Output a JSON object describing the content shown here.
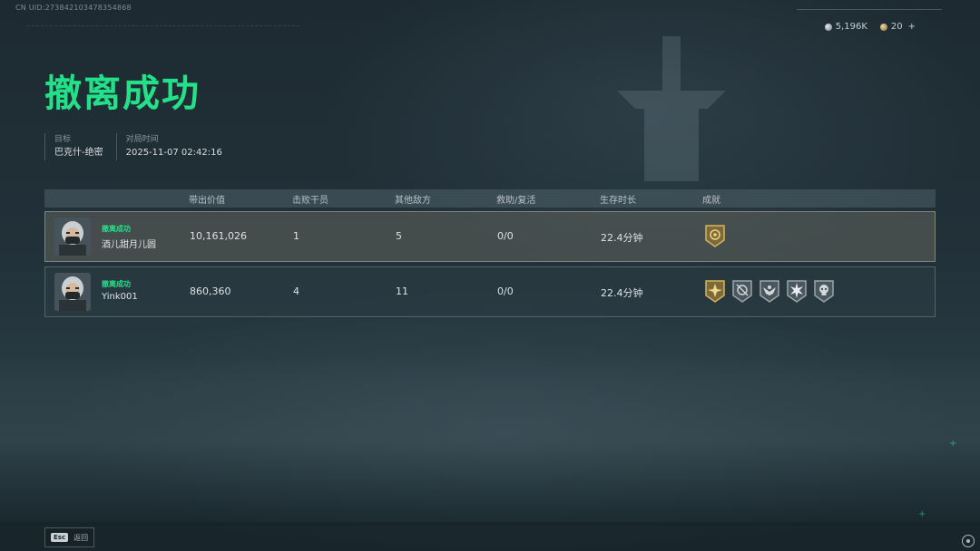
{
  "header": {
    "uid": "CN UID:273842103478354868",
    "currency": [
      {
        "icon": "silver-coin-icon",
        "value": "5,196K"
      },
      {
        "icon": "gold-coin-icon",
        "value": "20"
      }
    ],
    "add_symbol": "+"
  },
  "title": "撤离成功",
  "meta": [
    {
      "label": "目标",
      "value": "巴克什-绝密"
    },
    {
      "label": "对局时间",
      "value": "2025-11-07 02:42:16"
    }
  ],
  "table": {
    "columns": [
      "带出价值",
      "击败干员",
      "其他敌方",
      "救助/复活",
      "生存时长",
      "成就"
    ],
    "rows": [
      {
        "status": "撤离成功",
        "name": "酒儿甜月儿圆",
        "value": "10,161,026",
        "kills": "1",
        "others": "5",
        "rescue": "0/0",
        "time": "22.4分钟",
        "badges": [
          "gold-shield-badge-icon"
        ]
      },
      {
        "status": "撤离成功",
        "name": "Yink001",
        "value": "860,360",
        "kills": "4",
        "others": "11",
        "rescue": "0/0",
        "time": "22.4分钟",
        "badges": [
          "gold-star-badge-icon",
          "crosshair-badge-icon",
          "eagle-badge-icon",
          "burst-badge-icon",
          "skull-badge-icon"
        ]
      }
    ]
  },
  "footer": {
    "esc_key": "Esc",
    "esc_label": "返回"
  },
  "colors": {
    "accent": "#23e089",
    "badge_gold": "#c9a24c",
    "badge_silver": "#8e9aa1"
  }
}
